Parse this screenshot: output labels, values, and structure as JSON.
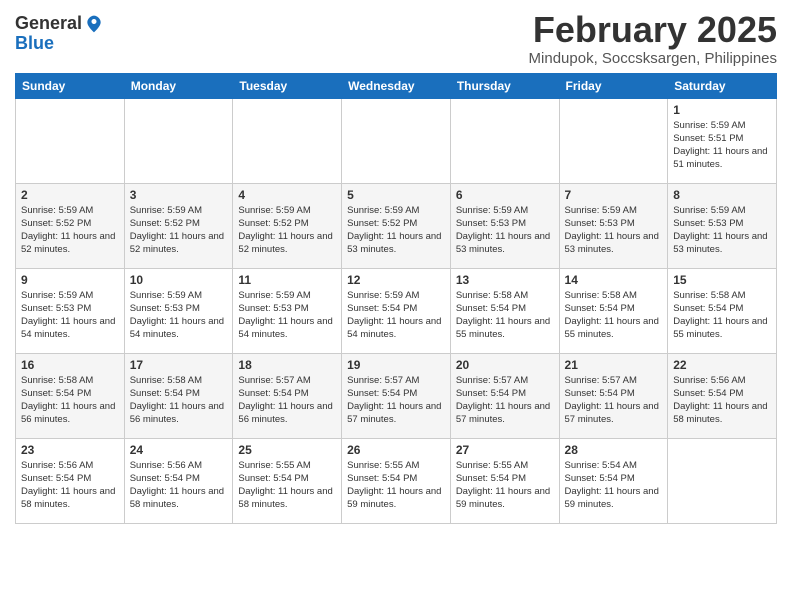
{
  "logo": {
    "general": "General",
    "blue": "Blue"
  },
  "header": {
    "month": "February 2025",
    "location": "Mindupok, Soccsksargen, Philippines"
  },
  "weekdays": [
    "Sunday",
    "Monday",
    "Tuesday",
    "Wednesday",
    "Thursday",
    "Friday",
    "Saturday"
  ],
  "weeks": [
    [
      null,
      null,
      null,
      null,
      null,
      null,
      {
        "day": 1,
        "sunrise": "5:59 AM",
        "sunset": "5:51 PM",
        "daylight": "11 hours and 51 minutes."
      }
    ],
    [
      {
        "day": 2,
        "sunrise": "5:59 AM",
        "sunset": "5:52 PM",
        "daylight": "11 hours and 52 minutes."
      },
      {
        "day": 3,
        "sunrise": "5:59 AM",
        "sunset": "5:52 PM",
        "daylight": "11 hours and 52 minutes."
      },
      {
        "day": 4,
        "sunrise": "5:59 AM",
        "sunset": "5:52 PM",
        "daylight": "11 hours and 52 minutes."
      },
      {
        "day": 5,
        "sunrise": "5:59 AM",
        "sunset": "5:52 PM",
        "daylight": "11 hours and 53 minutes."
      },
      {
        "day": 6,
        "sunrise": "5:59 AM",
        "sunset": "5:53 PM",
        "daylight": "11 hours and 53 minutes."
      },
      {
        "day": 7,
        "sunrise": "5:59 AM",
        "sunset": "5:53 PM",
        "daylight": "11 hours and 53 minutes."
      },
      {
        "day": 8,
        "sunrise": "5:59 AM",
        "sunset": "5:53 PM",
        "daylight": "11 hours and 53 minutes."
      }
    ],
    [
      {
        "day": 9,
        "sunrise": "5:59 AM",
        "sunset": "5:53 PM",
        "daylight": "11 hours and 54 minutes."
      },
      {
        "day": 10,
        "sunrise": "5:59 AM",
        "sunset": "5:53 PM",
        "daylight": "11 hours and 54 minutes."
      },
      {
        "day": 11,
        "sunrise": "5:59 AM",
        "sunset": "5:53 PM",
        "daylight": "11 hours and 54 minutes."
      },
      {
        "day": 12,
        "sunrise": "5:59 AM",
        "sunset": "5:54 PM",
        "daylight": "11 hours and 54 minutes."
      },
      {
        "day": 13,
        "sunrise": "5:58 AM",
        "sunset": "5:54 PM",
        "daylight": "11 hours and 55 minutes."
      },
      {
        "day": 14,
        "sunrise": "5:58 AM",
        "sunset": "5:54 PM",
        "daylight": "11 hours and 55 minutes."
      },
      {
        "day": 15,
        "sunrise": "5:58 AM",
        "sunset": "5:54 PM",
        "daylight": "11 hours and 55 minutes."
      }
    ],
    [
      {
        "day": 16,
        "sunrise": "5:58 AM",
        "sunset": "5:54 PM",
        "daylight": "11 hours and 56 minutes."
      },
      {
        "day": 17,
        "sunrise": "5:58 AM",
        "sunset": "5:54 PM",
        "daylight": "11 hours and 56 minutes."
      },
      {
        "day": 18,
        "sunrise": "5:57 AM",
        "sunset": "5:54 PM",
        "daylight": "11 hours and 56 minutes."
      },
      {
        "day": 19,
        "sunrise": "5:57 AM",
        "sunset": "5:54 PM",
        "daylight": "11 hours and 57 minutes."
      },
      {
        "day": 20,
        "sunrise": "5:57 AM",
        "sunset": "5:54 PM",
        "daylight": "11 hours and 57 minutes."
      },
      {
        "day": 21,
        "sunrise": "5:57 AM",
        "sunset": "5:54 PM",
        "daylight": "11 hours and 57 minutes."
      },
      {
        "day": 22,
        "sunrise": "5:56 AM",
        "sunset": "5:54 PM",
        "daylight": "11 hours and 58 minutes."
      }
    ],
    [
      {
        "day": 23,
        "sunrise": "5:56 AM",
        "sunset": "5:54 PM",
        "daylight": "11 hours and 58 minutes."
      },
      {
        "day": 24,
        "sunrise": "5:56 AM",
        "sunset": "5:54 PM",
        "daylight": "11 hours and 58 minutes."
      },
      {
        "day": 25,
        "sunrise": "5:55 AM",
        "sunset": "5:54 PM",
        "daylight": "11 hours and 58 minutes."
      },
      {
        "day": 26,
        "sunrise": "5:55 AM",
        "sunset": "5:54 PM",
        "daylight": "11 hours and 59 minutes."
      },
      {
        "day": 27,
        "sunrise": "5:55 AM",
        "sunset": "5:54 PM",
        "daylight": "11 hours and 59 minutes."
      },
      {
        "day": 28,
        "sunrise": "5:54 AM",
        "sunset": "5:54 PM",
        "daylight": "11 hours and 59 minutes."
      },
      null
    ]
  ]
}
